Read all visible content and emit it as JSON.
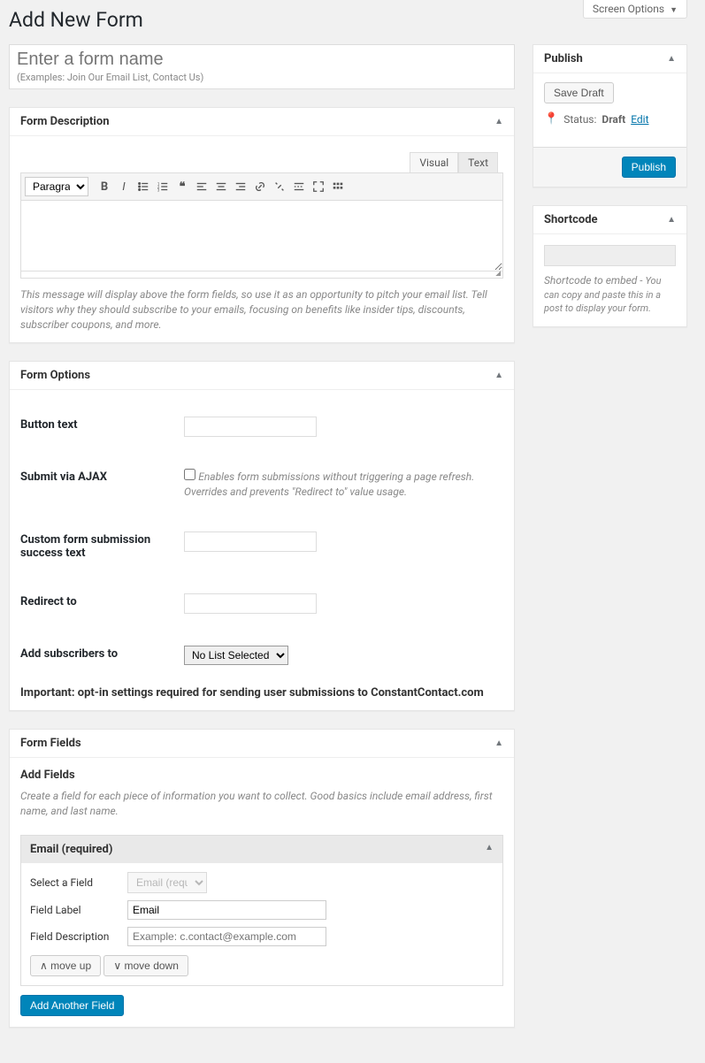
{
  "screen_options_label": "Screen Options",
  "page_title": "Add New Form",
  "title_input": {
    "placeholder": "Enter a form name",
    "examples": "(Examples: Join Our Email List, Contact Us)"
  },
  "form_description": {
    "heading": "Form Description",
    "tab_visual": "Visual",
    "tab_text": "Text",
    "format_select": "Paragraph",
    "hint": "This message will display above the form fields, so use it as an opportunity to pitch your email list. Tell visitors why they should subscribe to your emails, focusing on benefits like insider tips, discounts, subscriber coupons, and more."
  },
  "form_options": {
    "heading": "Form Options",
    "button_text_label": "Button text",
    "ajax_label": "Submit via AJAX",
    "ajax_desc": "Enables form submissions without triggering a page refresh. Overrides and prevents \"Redirect to\" value usage.",
    "success_text_label": "Custom form submission success text",
    "redirect_label": "Redirect to",
    "add_subs_label": "Add subscribers to",
    "list_select_value": "No List Selected",
    "important": "Important: opt-in settings required for sending user submissions to ConstantContact.com"
  },
  "form_fields": {
    "heading": "Form Fields",
    "add_heading": "Add Fields",
    "add_hint": "Create a field for each piece of information you want to collect. Good basics include email address, first name, and last name.",
    "panel_title": "Email (required)",
    "select_label": "Select a Field",
    "select_value": "Email (required)",
    "label_label": "Field Label",
    "label_value": "Email",
    "desc_label": "Field Description",
    "desc_placeholder": "Example: c.contact@example.com",
    "move_up": "move up",
    "move_down": "move down",
    "add_another": "Add Another Field"
  },
  "publish": {
    "heading": "Publish",
    "save_draft": "Save Draft",
    "status_label": "Status:",
    "status_value": "Draft",
    "edit": "Edit",
    "publish_btn": "Publish"
  },
  "shortcode": {
    "heading": "Shortcode",
    "hint_lead": "Shortcode to embed - ",
    "hint_rest": "You can copy and paste this in a post to display your form."
  }
}
